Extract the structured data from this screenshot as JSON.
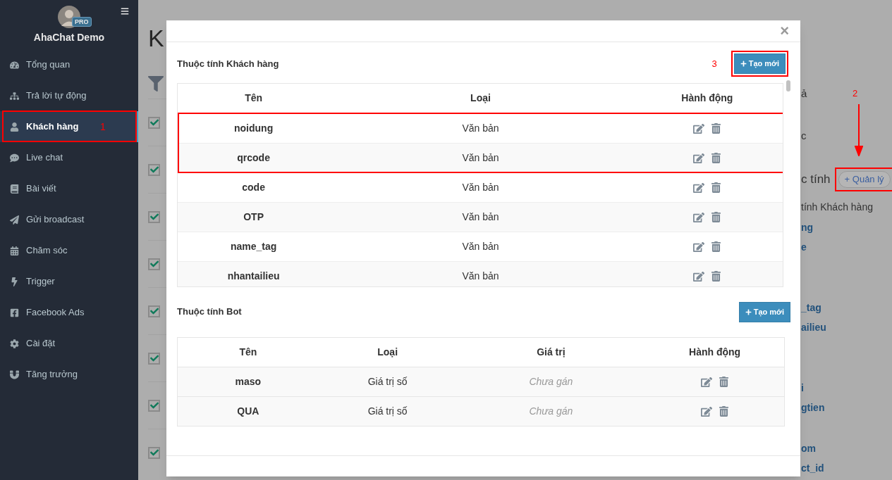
{
  "sidebar": {
    "user": "AhaChat Demo",
    "badge": "PRO",
    "items": [
      {
        "label": "Tổng quan",
        "selected": false
      },
      {
        "label": "Trả lời tự động",
        "selected": false
      },
      {
        "label": "Khách hàng",
        "selected": true
      },
      {
        "label": "Live chat",
        "selected": false
      },
      {
        "label": "Bài viết",
        "selected": false
      },
      {
        "label": "Gửi broadcast",
        "selected": false
      },
      {
        "label": "Chăm sóc",
        "selected": false
      },
      {
        "label": "Trigger",
        "selected": false
      },
      {
        "label": "Facebook Ads",
        "selected": false
      },
      {
        "label": "Cài đặt",
        "selected": false
      },
      {
        "label": "Tăng trưởng",
        "selected": false
      }
    ]
  },
  "background": {
    "title": "K",
    "rows": [
      {
        "checked": true
      },
      {
        "checked": true
      },
      {
        "checked": true
      },
      {
        "checked": true
      },
      {
        "checked": true
      },
      {
        "checked": true
      },
      {
        "checked": true
      },
      {
        "checked": true
      }
    ],
    "right_panel": {
      "line_1": "ả",
      "line_2": "c",
      "section": "c tính",
      "manage_button": "+ Quản lý",
      "subtitle": "tính Khách hàng",
      "link_groups": [
        [
          "ng",
          "e"
        ],
        [
          "_tag",
          "ailieu"
        ],
        [
          "i",
          "gtien"
        ],
        [
          "om",
          "ct_id"
        ]
      ]
    }
  },
  "modal": {
    "close": "×",
    "customer_section": {
      "title": "Thuộc tính Khách hàng",
      "button": "Tạo mới",
      "columns": [
        "Tên",
        "Loại",
        "Hành động"
      ],
      "rows": [
        {
          "name": "noidung",
          "type": "Văn bản"
        },
        {
          "name": "qrcode",
          "type": "Văn bản"
        },
        {
          "name": "code",
          "type": "Văn bản"
        },
        {
          "name": "OTP",
          "type": "Văn bản"
        },
        {
          "name": "name_tag",
          "type": "Văn bản"
        },
        {
          "name": "nhantailieu",
          "type": "Văn bản"
        }
      ]
    },
    "bot_section": {
      "title": "Thuộc tính Bot",
      "button": "Tạo mới",
      "columns": [
        "Tên",
        "Loại",
        "Giá trị",
        "Hành động"
      ],
      "rows": [
        {
          "name": "maso",
          "type": "Giá trị số",
          "value": "Chưa gán"
        },
        {
          "name": "QUA",
          "type": "Giá trị số",
          "value": "Chưa gán"
        }
      ]
    }
  },
  "annotations": [
    "1",
    "2",
    "3"
  ]
}
